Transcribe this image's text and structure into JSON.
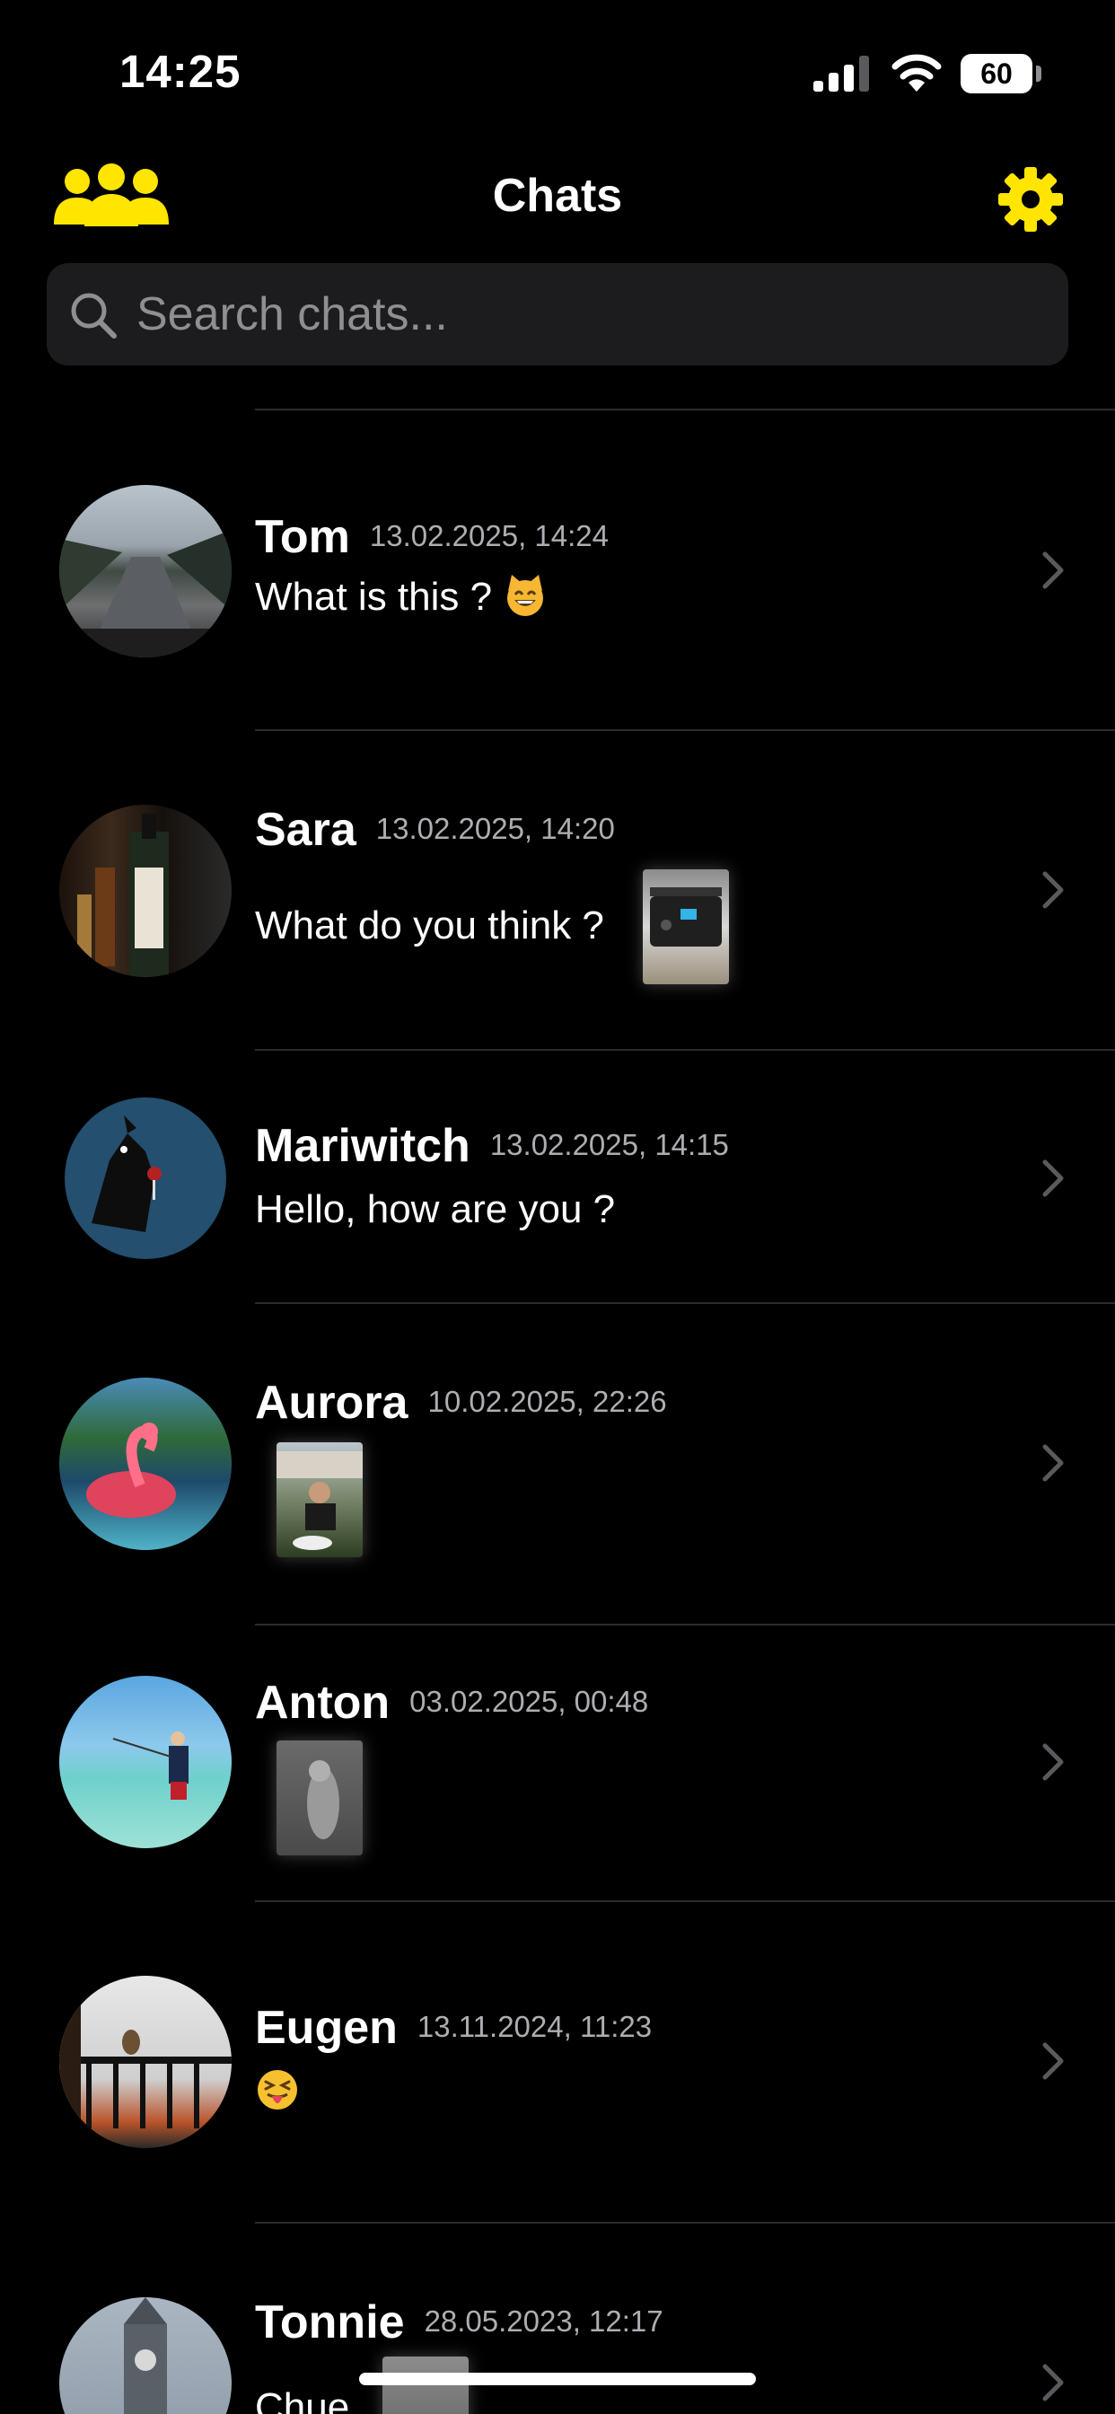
{
  "status_bar": {
    "time": "14:25",
    "battery": "60"
  },
  "header": {
    "title": "Chats",
    "left_icon": "people-icon",
    "right_icon": "gear-icon"
  },
  "search": {
    "placeholder": "Search chats...",
    "value": ""
  },
  "colors": {
    "accent": "#FFE500",
    "background": "#000000",
    "secondary_text": "#AEAEB2"
  },
  "chats": [
    {
      "name": "Tom",
      "date": "13.02.2025, 14:24",
      "message": "What is this ?",
      "emoji": "grinning-cat"
    },
    {
      "name": "Sara",
      "date": "13.02.2025, 14:20",
      "message": "What do you think ?",
      "attachment": "photo"
    },
    {
      "name": "Mariwitch",
      "date": "13.02.2025, 14:15",
      "message": "Hello, how are you ?"
    },
    {
      "name": "Aurora",
      "date": "10.02.2025, 22:26",
      "attachment": "photo"
    },
    {
      "name": "Anton",
      "date": "03.02.2025, 00:48",
      "attachment": "photo"
    },
    {
      "name": "Eugen",
      "date": "13.11.2024, 11:23",
      "emoji": "squinting-tongue-face"
    },
    {
      "name": "Tonnie",
      "date": "28.05.2023, 12:17",
      "message": "Chue"
    }
  ]
}
